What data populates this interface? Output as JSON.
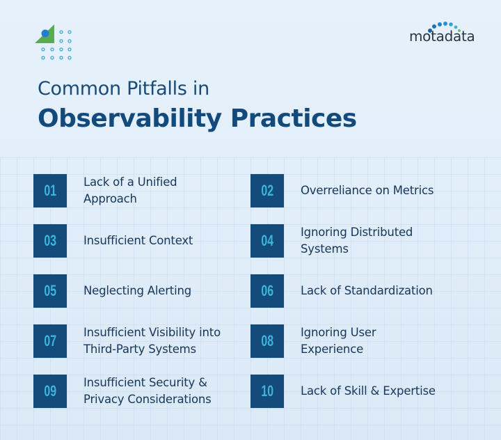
{
  "brand": {
    "logo_text": "motadata",
    "colors": {
      "primary": "#134b7b",
      "number_accent": "#3ab5dc",
      "title": "#124a7c",
      "text": "#16365a",
      "deco_green": "#5aaa55",
      "deco_blue": "#1f7fc9"
    }
  },
  "header": {
    "title_line1": "Common Pitfalls in",
    "title_line2": "Observability Practices"
  },
  "items": [
    {
      "number": "01",
      "label": "Lack of a Unified\nApproach"
    },
    {
      "number": "02",
      "label": "Overreliance on Metrics"
    },
    {
      "number": "03",
      "label": "Insufficient Context"
    },
    {
      "number": "04",
      "label": "Ignoring Distributed\nSystems"
    },
    {
      "number": "05",
      "label": "Neglecting Alerting"
    },
    {
      "number": "06",
      "label": "Lack of Standardization"
    },
    {
      "number": "07",
      "label": "Insufficient Visibility into\nThird-Party Systems"
    },
    {
      "number": "08",
      "label": "Ignoring User\nExperience"
    },
    {
      "number": "09",
      "label": "Insufficient Security &\nPrivacy Considerations"
    },
    {
      "number": "10",
      "label": "Lack of Skill & Expertise"
    }
  ]
}
